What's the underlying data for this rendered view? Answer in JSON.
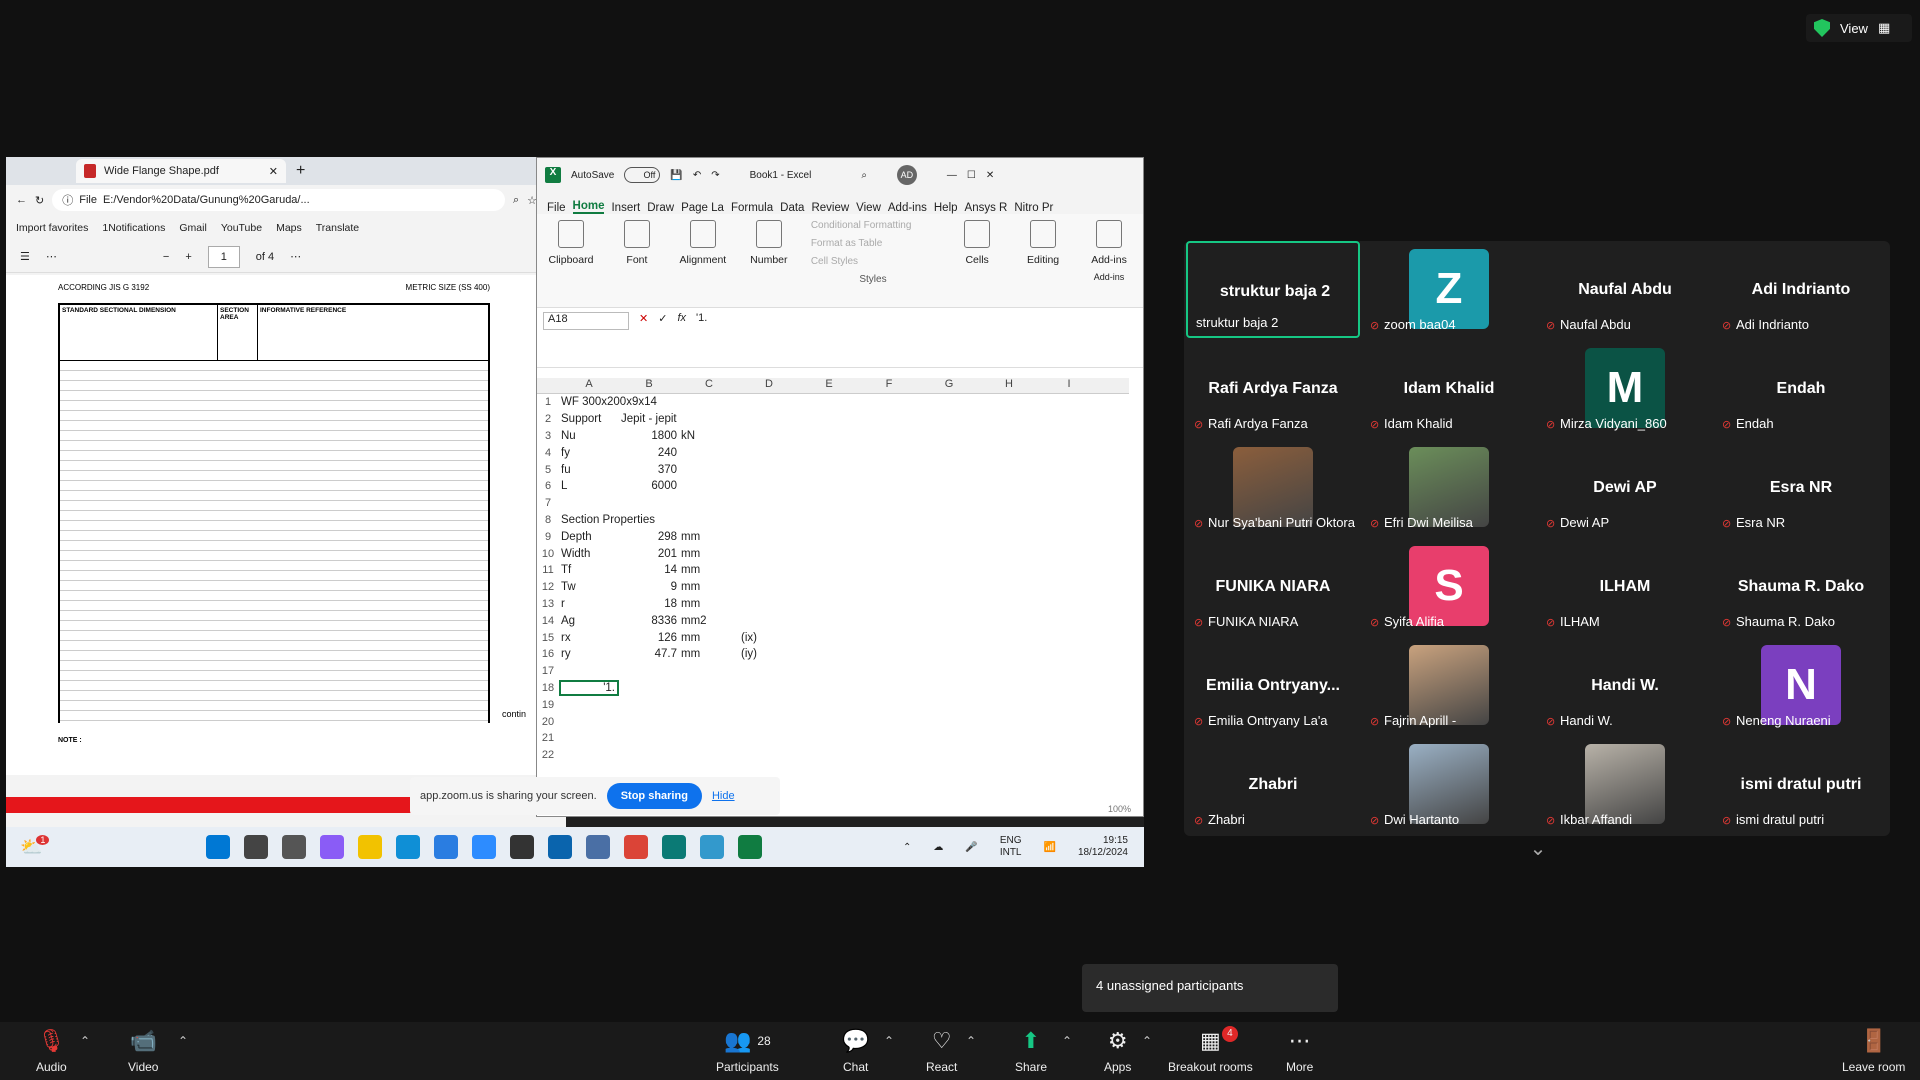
{
  "view": {
    "label": "View"
  },
  "edge": {
    "tab_title": "Wide Flange Shape.pdf",
    "url_prefix": "File",
    "url": "E:/Vendor%20Data/Gunung%20Garuda/...",
    "favorites": [
      "Import favorites",
      "1Notifications",
      "Gmail",
      "YouTube",
      "Maps",
      "Translate"
    ],
    "page_number": "1",
    "page_total": "of 4",
    "pdf_header_left": "ACCORDING JIS G 3192",
    "pdf_header_right": "METRIC SIZE (SS 400)",
    "table_title_left": "STANDARD SECTIONAL DIMENSION",
    "table_title_mid": "SECTION AREA",
    "table_title_right": "INFORMATIVE REFERENCE",
    "note": "NOTE :",
    "continued": "contin"
  },
  "excel": {
    "autosave": "AutoSave",
    "toggle": "Off",
    "title": "Book1 - Excel",
    "user_initials": "AD",
    "menu": [
      "File",
      "Home",
      "Insert",
      "Draw",
      "Page La",
      "Formula",
      "Data",
      "Review",
      "View",
      "Add-ins",
      "Help",
      "Ansys R",
      "Nitro Pr"
    ],
    "ribbon": {
      "clipboard": "Clipboard",
      "font": "Font",
      "alignment": "Alignment",
      "number": "Number",
      "cond_format": "Conditional Formatting",
      "format_table": "Format as Table",
      "cell_styles": "Cell Styles",
      "styles_group": "Styles",
      "cells": "Cells",
      "editing": "Editing",
      "addins": "Add-ins",
      "addins_group": "Add-ins"
    },
    "name_box": "A18",
    "formula": "'1.",
    "columns": [
      "A",
      "B",
      "C",
      "D",
      "E",
      "F",
      "G",
      "H",
      "I"
    ],
    "rows": [
      {
        "n": "1",
        "a": "WF 300x200x9x14",
        "b": "",
        "c": "",
        "d": ""
      },
      {
        "n": "2",
        "a": "Support",
        "b": "Jepit - jepit",
        "c": "",
        "d": ""
      },
      {
        "n": "3",
        "a": "Nu",
        "b": "1800",
        "c": "kN",
        "d": ""
      },
      {
        "n": "4",
        "a": "fy",
        "b": "240",
        "c": "",
        "d": ""
      },
      {
        "n": "5",
        "a": "fu",
        "b": "370",
        "c": "",
        "d": ""
      },
      {
        "n": "6",
        "a": "L",
        "b": "6000",
        "c": "",
        "d": ""
      },
      {
        "n": "7",
        "a": "",
        "b": "",
        "c": "",
        "d": ""
      },
      {
        "n": "8",
        "a": "Section Properties",
        "b": "",
        "c": "",
        "d": ""
      },
      {
        "n": "9",
        "a": "Depth",
        "b": "298",
        "c": "mm",
        "d": ""
      },
      {
        "n": "10",
        "a": "Width",
        "b": "201",
        "c": "mm",
        "d": ""
      },
      {
        "n": "11",
        "a": "Tf",
        "b": "14",
        "c": "mm",
        "d": ""
      },
      {
        "n": "12",
        "a": "Tw",
        "b": "9",
        "c": "mm",
        "d": ""
      },
      {
        "n": "13",
        "a": "r",
        "b": "18",
        "c": "mm",
        "d": ""
      },
      {
        "n": "14",
        "a": "Ag",
        "b": "8336",
        "c": "mm2",
        "d": ""
      },
      {
        "n": "15",
        "a": "rx",
        "b": "126",
        "c": "mm",
        "d": "(ix)"
      },
      {
        "n": "16",
        "a": "ry",
        "b": "47.7",
        "c": "mm",
        "d": "(iy)"
      },
      {
        "n": "17",
        "a": "",
        "b": "",
        "c": "",
        "d": ""
      },
      {
        "n": "18",
        "a": "'1.",
        "b": "",
        "c": "",
        "d": ""
      },
      {
        "n": "19",
        "a": "",
        "b": "",
        "c": "",
        "d": ""
      },
      {
        "n": "20",
        "a": "",
        "b": "",
        "c": "",
        "d": ""
      },
      {
        "n": "21",
        "a": "",
        "b": "",
        "c": "",
        "d": ""
      },
      {
        "n": "22",
        "a": "",
        "b": "",
        "c": "",
        "d": ""
      }
    ],
    "zoom_level": "100%"
  },
  "share_bar": {
    "text": "app.zoom.us is sharing your screen.",
    "stop": "Stop sharing",
    "hide": "Hide"
  },
  "taskbar": {
    "lang_top": "ENG",
    "lang_bottom": "INTL",
    "time": "19:15",
    "date": "18/12/2024",
    "notif_count": "1"
  },
  "participants": [
    {
      "display": "struktur baja 2",
      "label": "struktur baja 2",
      "avatar": "",
      "avatar_color": "",
      "active": true
    },
    {
      "display": "",
      "label": "zoom baa04",
      "avatar": "Z",
      "avatar_color": "#1b9aaa"
    },
    {
      "display": "Naufal Abdu",
      "label": "Naufal Abdu",
      "avatar": "",
      "avatar_color": ""
    },
    {
      "display": "Adi Indrianto",
      "label": "Adi Indrianto",
      "avatar": "",
      "avatar_color": ""
    },
    {
      "display": "Rafi Ardya Fanza",
      "label": "Rafi Ardya Fanza",
      "avatar": "",
      "avatar_color": ""
    },
    {
      "display": "Idam Khalid",
      "label": "Idam Khalid",
      "avatar": "",
      "avatar_color": ""
    },
    {
      "display": "",
      "label": "Mirza Vidyani_860",
      "avatar": "M",
      "avatar_color": "#0b5345"
    },
    {
      "display": "Endah",
      "label": "Endah",
      "avatar": "",
      "avatar_color": ""
    },
    {
      "display": "",
      "label": "Nur Sya'bani Putri Oktora",
      "avatar": "",
      "avatar_color": "",
      "photo": "#8b5e3c"
    },
    {
      "display": "",
      "label": "Efri Dwi Meilisa",
      "avatar": "",
      "avatar_color": "",
      "photo": "#6b8e5a"
    },
    {
      "display": "Dewi AP",
      "label": "Dewi AP",
      "avatar": "",
      "avatar_color": ""
    },
    {
      "display": "Esra NR",
      "label": "Esra NR",
      "avatar": "",
      "avatar_color": ""
    },
    {
      "display": "FUNIKA NIARA",
      "label": "FUNIKA NIARA",
      "avatar": "",
      "avatar_color": ""
    },
    {
      "display": "",
      "label": "Syifa Alifia",
      "avatar": "S",
      "avatar_color": "#e83e6c"
    },
    {
      "display": "ILHAM",
      "label": "ILHAM",
      "avatar": "",
      "avatar_color": ""
    },
    {
      "display": "Shauma R. Dako",
      "label": "Shauma R. Dako",
      "avatar": "",
      "avatar_color": ""
    },
    {
      "display": "Emilia Ontryany...",
      "label": "Emilia Ontryany La'a",
      "avatar": "",
      "avatar_color": ""
    },
    {
      "display": "",
      "label": "Fajrin Aprill -",
      "avatar": "",
      "avatar_color": "",
      "photo": "#c9a27e"
    },
    {
      "display": "Handi W.",
      "label": "Handi W.",
      "avatar": "",
      "avatar_color": ""
    },
    {
      "display": "",
      "label": "Neneng Nuraeni",
      "avatar": "N",
      "avatar_color": "#7b3fbf"
    },
    {
      "display": "Zhabri",
      "label": "Zhabri",
      "avatar": "",
      "avatar_color": ""
    },
    {
      "display": "",
      "label": "Dwi Hartanto",
      "avatar": "",
      "avatar_color": "",
      "photo": "#9ab0c4"
    },
    {
      "display": "",
      "label": "Ikbar Affandi",
      "avatar": "",
      "avatar_color": "",
      "photo": "#b8b2a8"
    },
    {
      "display": "ismi dratul putri",
      "label": "ismi dratul putri",
      "avatar": "",
      "avatar_color": ""
    }
  ],
  "unassigned": "4 unassigned participants",
  "toolbar": {
    "audio": "Audio",
    "video": "Video",
    "participants": "Participants",
    "participants_count": "28",
    "chat": "Chat",
    "react": "React",
    "share": "Share",
    "apps": "Apps",
    "breakout": "Breakout rooms",
    "breakout_badge": "4",
    "more": "More",
    "leave": "Leave room"
  }
}
